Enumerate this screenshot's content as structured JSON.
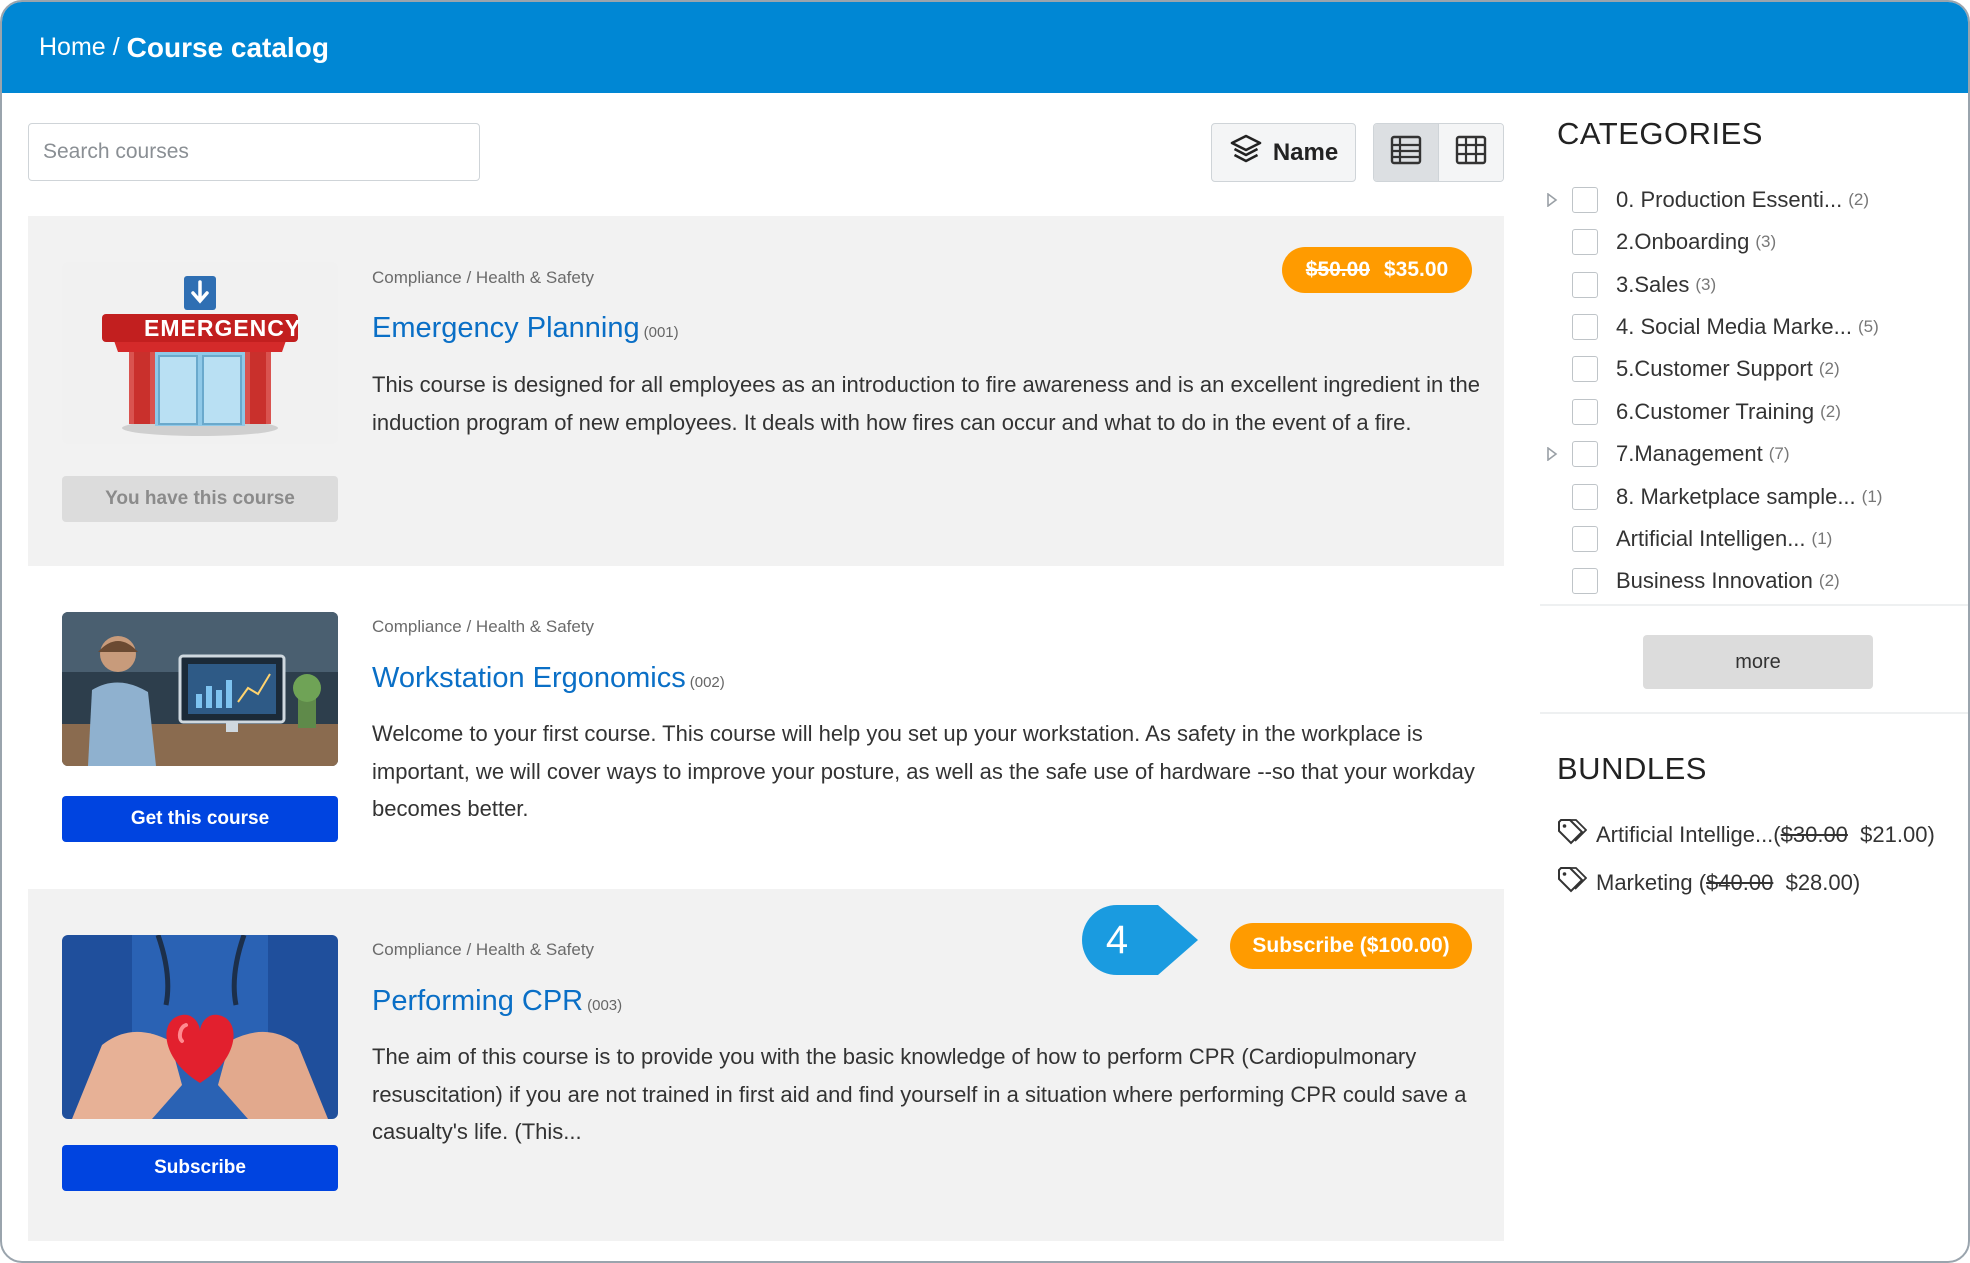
{
  "breadcrumb": {
    "home": "Home",
    "separator": "/",
    "current": "Course catalog"
  },
  "toolbar": {
    "search_placeholder": "Search courses",
    "sort_label": "Name",
    "sort_icon": "layers-icon",
    "views": [
      {
        "name": "list-view",
        "active": true
      },
      {
        "name": "grid-view",
        "active": false
      }
    ]
  },
  "courses": [
    {
      "category": "Compliance / Health & Safety",
      "title": "Emergency Planning",
      "code": "(001)",
      "description": "This course is designed for all employees as an introduction to fire awareness and is an excellent ingredient in the induction program of new employees. It deals with how fires can occur and what to do in the event of a fire.",
      "price_old": "$50.00",
      "price_new": "$35.00",
      "button": "You have this course",
      "image": "emergency-building-illustration"
    },
    {
      "category": "Compliance / Health & Safety",
      "title": "Workstation Ergonomics",
      "code": "(002)",
      "description": "Welcome to your first course. This course will help you set up your workstation. As safety in the workplace is important, we will cover ways to improve your posture, as well as the safe use of hardware --so that your workday becomes better.",
      "button": "Get this course",
      "image": "person-at-computer-photo"
    },
    {
      "category": "Compliance / Health & Safety",
      "title": "Performing CPR",
      "code": "(003)",
      "description": "The aim of this course is to provide you with the basic knowledge of how to perform CPR (Cardiopulmonary resuscitation) if you are not trained in first aid and find yourself in a situation where performing CPR could save a casualty's life. (This...",
      "subscribe_pill": "Subscribe ($100.00)",
      "button": "Subscribe",
      "image": "hands-holding-heart-photo"
    }
  ],
  "callout": {
    "number": "4",
    "color": "#1a9be0"
  },
  "sidebar": {
    "categories_title": "CATEGORIES",
    "categories": [
      {
        "name": "0. Production Essenti...",
        "count": "(2)",
        "expandable": true
      },
      {
        "name": "2.Onboarding",
        "count": "(3)",
        "expandable": false
      },
      {
        "name": "3.Sales",
        "count": "(3)",
        "expandable": false
      },
      {
        "name": "4. Social Media Marke...",
        "count": "(5)",
        "expandable": false
      },
      {
        "name": "5.Customer Support",
        "count": "(2)",
        "expandable": false
      },
      {
        "name": "6.Customer Training",
        "count": "(2)",
        "expandable": false
      },
      {
        "name": "7.Management",
        "count": "(7)",
        "expandable": true
      },
      {
        "name": "8. Marketplace sample...",
        "count": "(1)",
        "expandable": false
      },
      {
        "name": "Artificial Intelligen...",
        "count": "(1)",
        "expandable": false
      },
      {
        "name": "Business Innovation",
        "count": "(2)",
        "expandable": false
      }
    ],
    "more_label": "more",
    "bundles_title": "BUNDLES",
    "bundles": [
      {
        "name": "Artificial Intellige...",
        "open": "(",
        "price_old": "$30.00",
        "price_new": "$21.00",
        "close": ")"
      },
      {
        "name": "Marketing",
        "open": "(",
        "price_old": "$40.00",
        "price_new": "$28.00",
        "close": ")"
      }
    ]
  },
  "colors": {
    "header": "#0087d4",
    "accent_orange": "#ff9b00",
    "primary_button": "#0044e0",
    "link": "#0a6fc6"
  }
}
